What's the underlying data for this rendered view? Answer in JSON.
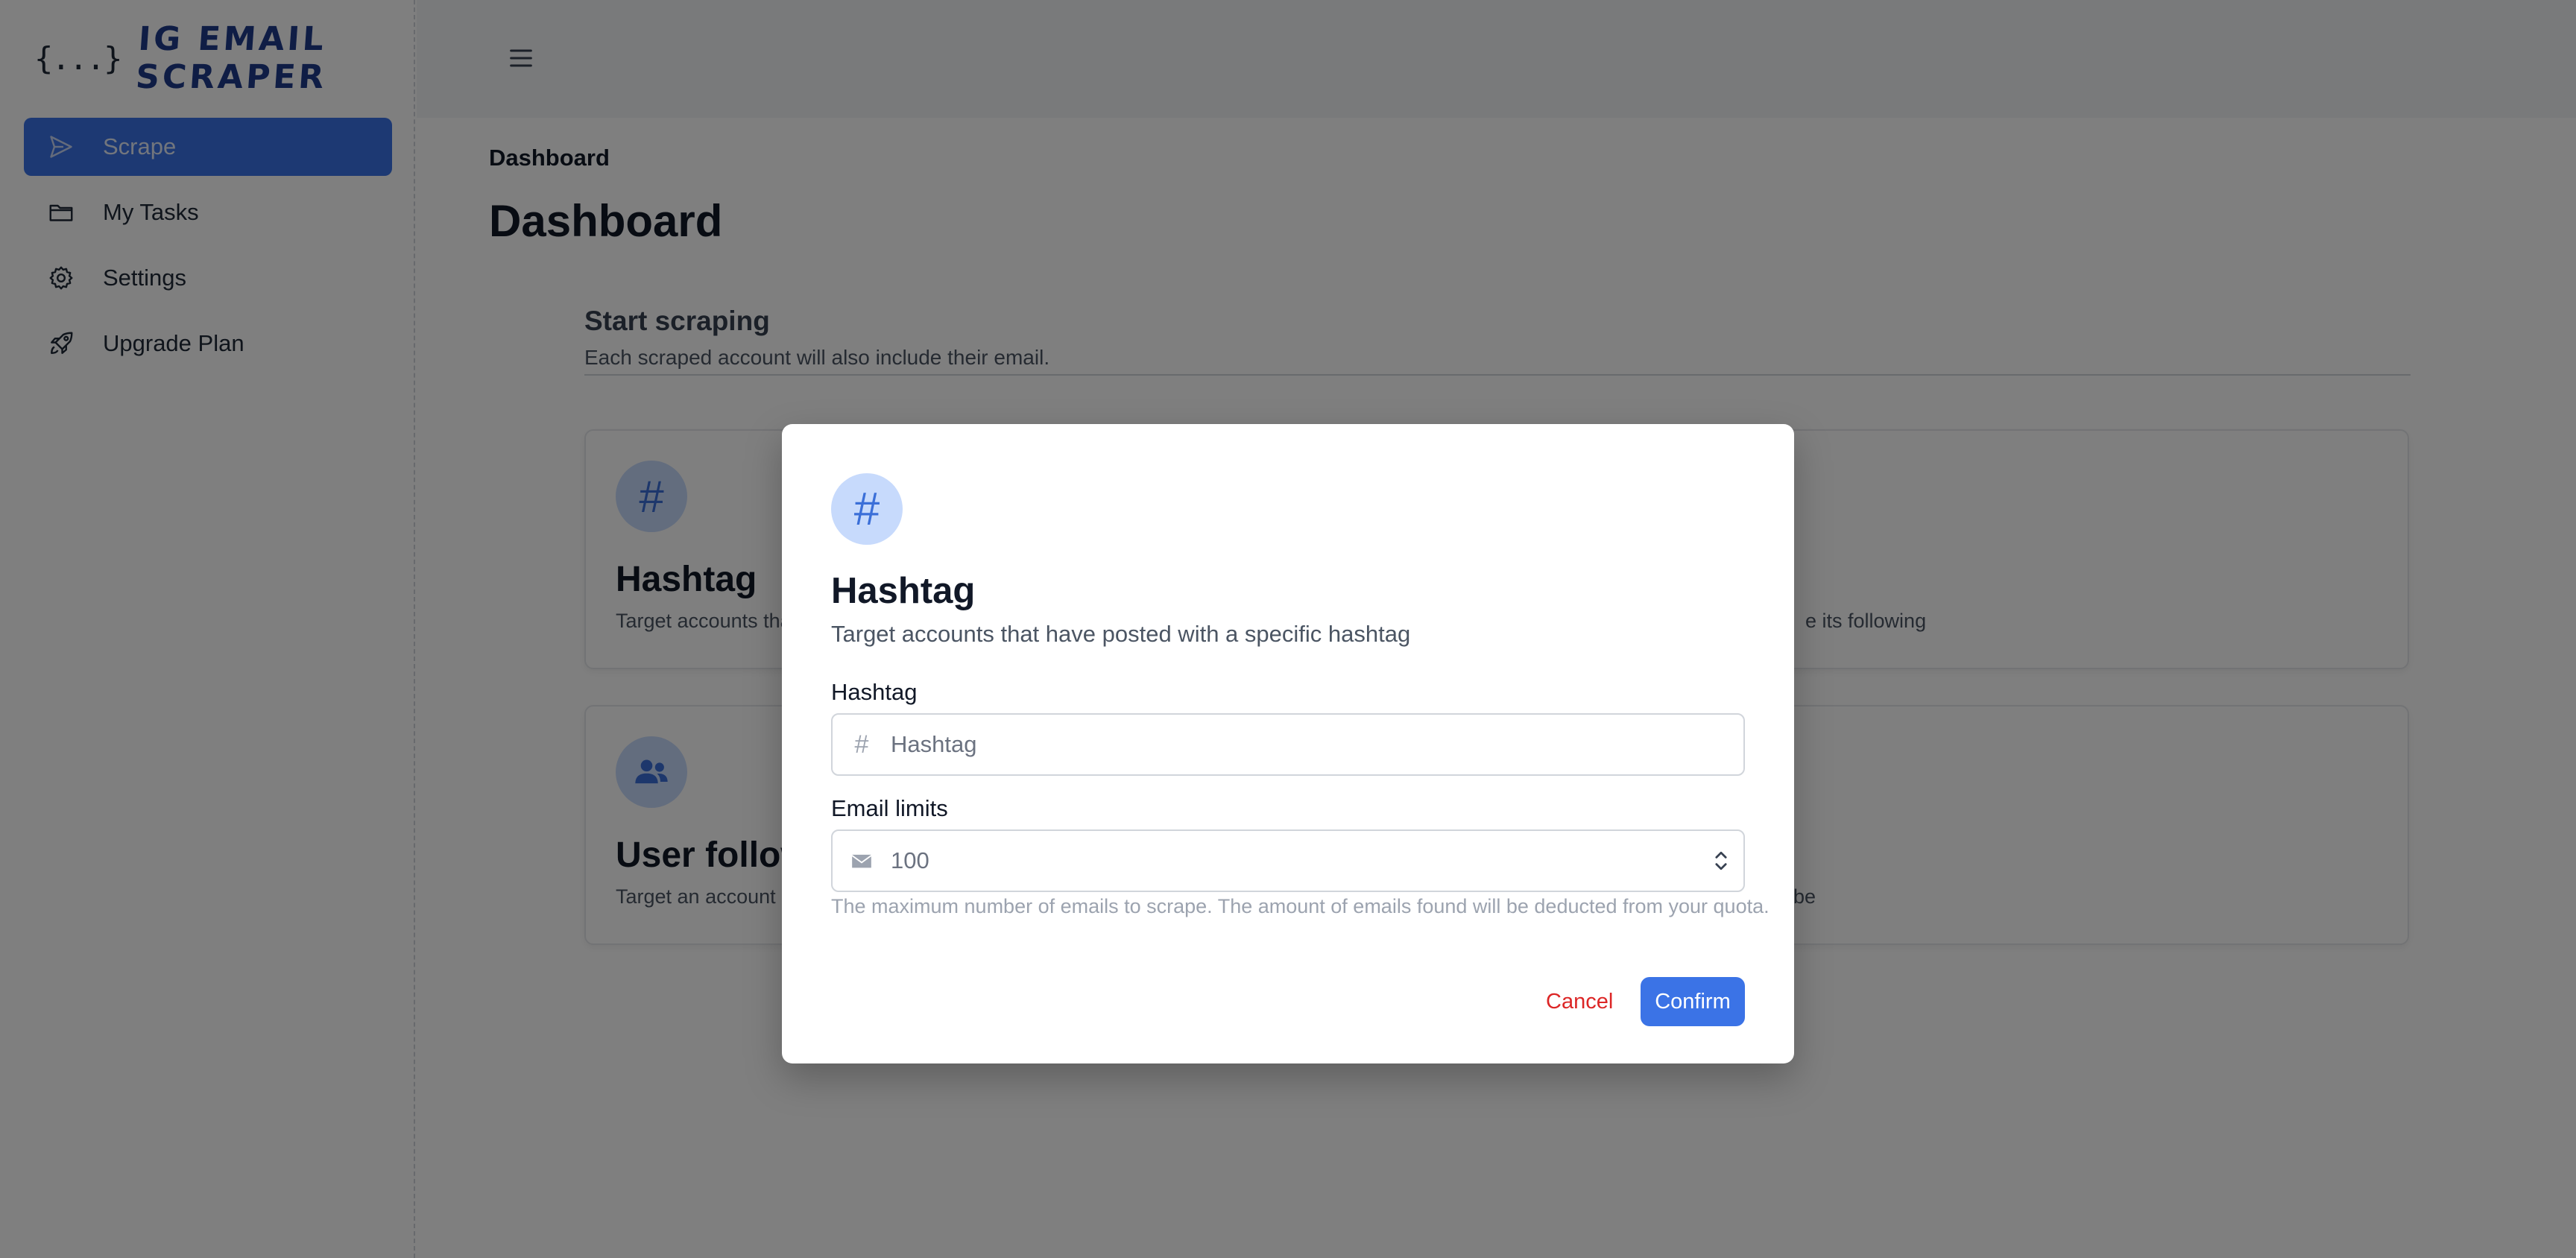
{
  "app": {
    "brand": "IG EMAIL SCRAPER",
    "brand_icon": "{...}"
  },
  "sidebar": {
    "items": [
      {
        "label": "Scrape",
        "icon": "send-icon",
        "active": true
      },
      {
        "label": "My Tasks",
        "icon": "folder-icon",
        "active": false
      },
      {
        "label": "Settings",
        "icon": "gear-icon",
        "active": false
      },
      {
        "label": "Upgrade Plan",
        "icon": "rocket-icon",
        "active": false
      }
    ]
  },
  "header": {
    "menu_icon": "hamburger-icon"
  },
  "page": {
    "breadcrumb": "Dashboard",
    "title": "Dashboard",
    "section_title": "Start scraping",
    "section_subtitle": "Each scraped account will also include their email."
  },
  "cards": [
    {
      "title": "Hashtag",
      "description": "Target accounts tha",
      "icon": "hash-icon",
      "glyph": "#"
    },
    {
      "title": "",
      "description": "e its following",
      "icon": "",
      "glyph": ""
    },
    {
      "title": "User follow",
      "description": "Target an account a",
      "icon": "users-icon",
      "glyph": ""
    },
    {
      "title": "",
      "description": "be",
      "icon": "",
      "glyph": ""
    }
  ],
  "modal": {
    "icon": "hash-icon",
    "icon_glyph": "#",
    "title": "Hashtag",
    "subtitle": "Target accounts that have posted with a specific hashtag",
    "hashtag_label": "Hashtag",
    "hashtag_field_glyph": "#",
    "hashtag_placeholder": "Hashtag",
    "hashtag_value": "",
    "limit_label": "Email limits",
    "limit_value": "100",
    "help_text": "The maximum number of emails to scrape. The amount of emails found will be deducted from your quota.",
    "cancel_label": "Cancel",
    "confirm_label": "Confirm"
  },
  "colors": {
    "accent": "#3b73e6",
    "brand": "#1e3a8a",
    "danger": "#dc2626",
    "icon_bg": "#c7dafc"
  }
}
